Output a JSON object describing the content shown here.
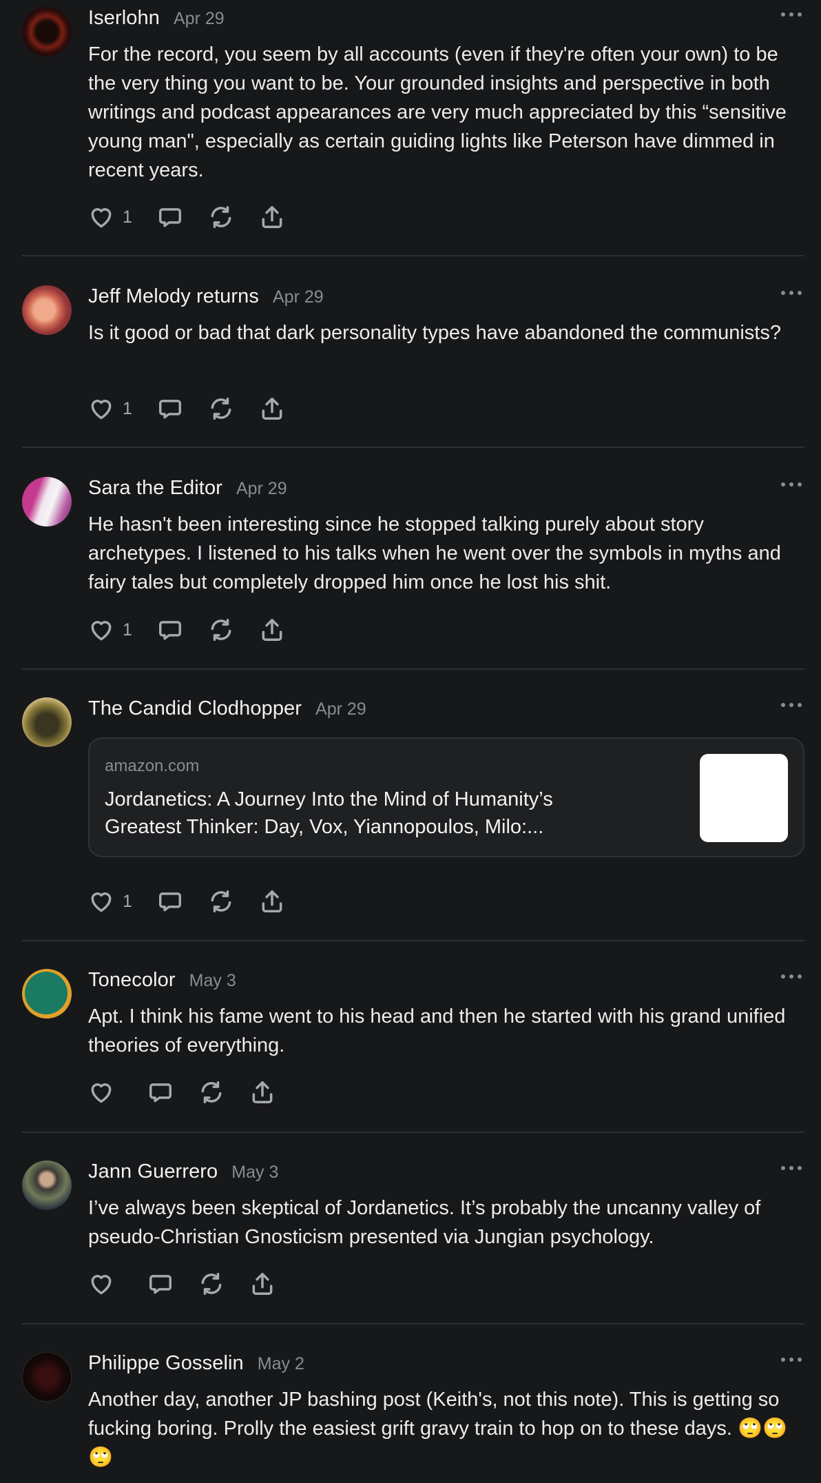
{
  "posts": [
    {
      "author": "Iserlohn",
      "date": "Apr 29",
      "text": "For the record, you seem by all accounts (even if they're often your own) to be the very thing you want to be. Your grounded insights and perspective in both writings and podcast appearances are very much appreciated by this “sensitive young man\", especially as certain guiding lights like Peterson have dimmed in recent years.",
      "likes": "1"
    },
    {
      "author": "Jeff Melody returns",
      "date": "Apr 29",
      "text": "Is it good or bad that dark personality types have abandoned the communists?",
      "likes": "1"
    },
    {
      "author": "Sara the Editor",
      "date": "Apr 29",
      "text": "He hasn't been interesting since he stopped talking purely about story archetypes. I listened to his talks when he went over the symbols in myths and fairy tales but completely dropped him once he lost his shit.",
      "likes": "1"
    },
    {
      "author": "The Candid Clodhopper",
      "date": "Apr 29",
      "link": {
        "domain": "amazon.com",
        "title": "Jordanetics: A Journey Into the Mind of Humanity’s Greatest Thinker: Day, Vox, Yiannopoulos, Milo:..."
      },
      "likes": "1"
    },
    {
      "author": "Tonecolor",
      "date": "May 3",
      "text": "Apt. I think his fame went to his head and then he started with his grand unified theories of everything.",
      "likes": ""
    },
    {
      "author": "Jann Guerrero",
      "date": "May 3",
      "text": "I’ve always been skeptical of Jordanetics. It’s probably the uncanny valley of pseudo-Christian Gnosticism presented via Jungian psychology.",
      "likes": ""
    },
    {
      "author": "Philippe Gosselin",
      "date": "May 2",
      "text": "Another day, another JP bashing post (Keith's, not this note). This is getting so fucking boring. Prolly the easiest grift gravy train to hop on to these days. 🙄🙄🙄",
      "likes": ""
    }
  ],
  "icons": [
    "heart-icon",
    "comment-icon",
    "restack-icon",
    "share-icon",
    "more-options-icon"
  ],
  "colors": {
    "background": "#17181a",
    "text": "#ececec",
    "muted": "#8a8c90",
    "divider": "#2e3033"
  }
}
